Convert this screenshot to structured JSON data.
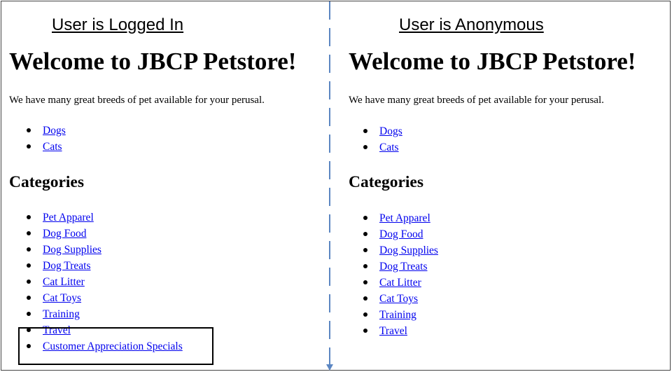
{
  "left": {
    "caption": "User is Logged In",
    "welcome": "Welcome to JBCP Petstore!",
    "intro": "We have many great breeds of pet available for your perusal.",
    "pets": [
      "Dogs",
      "Cats"
    ],
    "categories_heading": "Categories",
    "categories": [
      "Pet Apparel",
      "Dog Food",
      "Dog Supplies",
      "Dog Treats",
      "Cat Litter",
      "Cat Toys",
      "Training",
      "Travel",
      "Customer Appreciation Specials"
    ]
  },
  "right": {
    "caption": "User is Anonymous",
    "welcome": "Welcome to JBCP Petstore!",
    "intro": "We have many great breeds of pet available for your perusal.",
    "pets": [
      "Dogs",
      "Cats"
    ],
    "categories_heading": "Categories",
    "categories": [
      "Pet Apparel",
      "Dog Food",
      "Dog Supplies",
      "Dog Treats",
      "Cat Litter",
      "Cat Toys",
      "Training",
      "Travel"
    ]
  },
  "colors": {
    "link": "#0000ee",
    "divider": "#5b86c2",
    "highlight_border": "#000000"
  }
}
